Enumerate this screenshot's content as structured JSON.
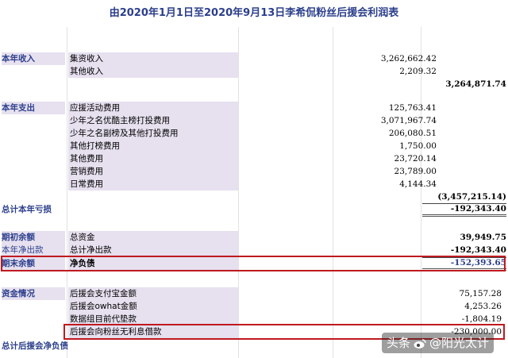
{
  "title": "由2020年1月1日至2020年9月13日李希侃粉丝后援会利润表",
  "income": {
    "category": "本年收入",
    "items": [
      {
        "label": "集资收入",
        "amount": "3,262,662.42"
      },
      {
        "label": "其他收入",
        "amount": "2,209.32"
      }
    ],
    "total": "3,264,871.74"
  },
  "expense": {
    "category": "本年支出",
    "items": [
      {
        "label": "应援活动费用",
        "amount": "125,763.41"
      },
      {
        "label": "少年之名优酷主榜打投费用",
        "amount": "3,071,967.74"
      },
      {
        "label": "少年之名副榜及其他打投费用",
        "amount": "206,080.51"
      },
      {
        "label": "其他打榜费用",
        "amount": "1,750.00"
      },
      {
        "label": "其他费用",
        "amount": "23,720.14"
      },
      {
        "label": "营销费用",
        "amount": "23,789.00"
      },
      {
        "label": "日常费用",
        "amount": "4,144.34"
      }
    ],
    "total": "(3,457,215.14)"
  },
  "loss": {
    "category": "总计本年亏损",
    "total": "-192,343.40"
  },
  "balance": {
    "opening": {
      "category": "期初余额",
      "label": "总资金",
      "total": "39,949.75"
    },
    "net_out": {
      "category": "本年净出款",
      "label": "总计净出款",
      "total": "-192,343.40"
    },
    "closing": {
      "category": "期末余额",
      "label": "净负债",
      "total": "-152,393.65"
    }
  },
  "funds": {
    "category": "资金情况",
    "items": [
      {
        "label": "后援会支付宝金额",
        "amount": "75,157.28"
      },
      {
        "label": "后援会owhat金额",
        "amount": "4,253.26"
      },
      {
        "label": "数据组目前代垫款",
        "amount": "-1,804.19"
      },
      {
        "label": "后援会向粉丝无利息借款",
        "amount": "-230,000.00"
      }
    ]
  },
  "net_debt": {
    "category": "总计后援会净负债"
  },
  "watermark": {
    "text_prefix": "头条",
    "text_suffix": "@阳光太计"
  },
  "colors": {
    "category_text": "#2c3f8c",
    "shade": "#e6e0ef",
    "highlight_box": "#c0191f"
  }
}
